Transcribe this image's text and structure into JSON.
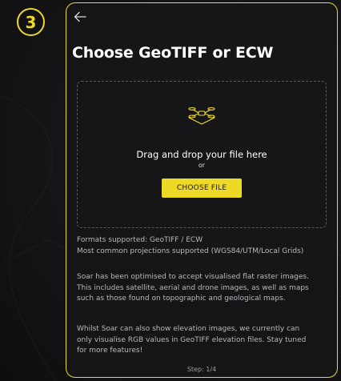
{
  "step_badge": "3",
  "panel": {
    "title": "Choose GeoTIFF or ECW",
    "back_icon": "arrow-left-icon"
  },
  "dropzone": {
    "icon": "drone-icon",
    "drag_text": "Drag and drop your file here",
    "or_text": "or",
    "choose_button": "CHOOSE FILE"
  },
  "info": {
    "formats": [
      "Formats supported: GeoTIFF / ECW",
      "Most common projections supported (WGS84/UTM/Local Grids)"
    ],
    "optimised": [
      "Soar has been optimised to accept visualised flat raster images.",
      "This includes satellite, aerial and drone images, as well as maps",
      "such as those found on topographic and geological maps."
    ],
    "elevation": [
      "Whilst Soar can also show elevation images, we currently can",
      "only visualise RGB values in GeoTIFF elevation files. Stay tuned",
      "for more features!"
    ]
  },
  "step_text": "Step: 1/4",
  "colors": {
    "accent": "#eed926",
    "background": "#161618",
    "text": "#ffffff",
    "muted_text": "#b9b9bd"
  }
}
